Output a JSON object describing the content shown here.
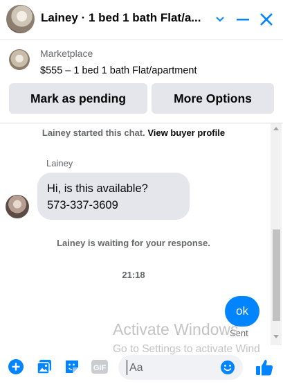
{
  "header": {
    "title": "Lainey · 1 bed 1 bath Flat/a...",
    "avatar_icon": "profile-photo",
    "icons": [
      "chevron-down-icon",
      "minimize-icon",
      "close-icon"
    ],
    "accent": "#0084ff"
  },
  "listing": {
    "label": "Marketplace",
    "title": "$555 – 1 bed 1 bath Flat/apartment",
    "buttons": {
      "mark_pending": "Mark as pending",
      "more_options": "More Options"
    }
  },
  "chat": {
    "started_text": "Lainey started this chat.",
    "view_profile": "View buyer profile",
    "sender_name": "Lainey",
    "incoming_line1": "Hi, is this available?",
    "incoming_line2": "573-337-3609",
    "waiting_text": "Lainey is waiting for your response.",
    "timestamp": "21:18",
    "outgoing": "ok",
    "status": "Sent"
  },
  "watermark": {
    "line1": "Activate Windows",
    "line2": "Go to Settings to activate Wind"
  },
  "composer": {
    "placeholder": "Aa",
    "icons": [
      "add-circle-icon",
      "photo-icon",
      "sticker-icon",
      "gif-icon",
      "emoji-icon",
      "thumbs-up-icon"
    ]
  }
}
